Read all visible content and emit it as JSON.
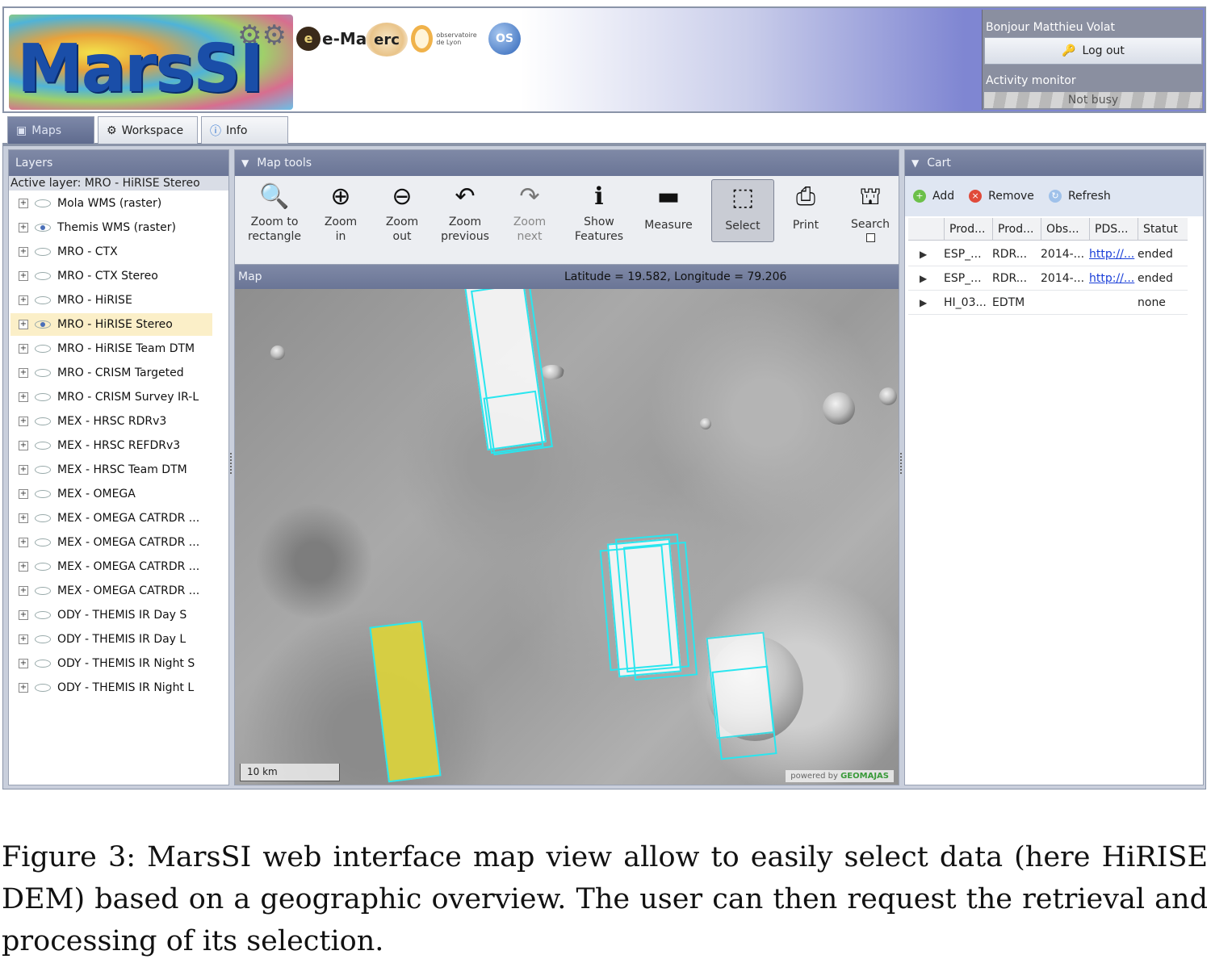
{
  "header": {
    "logo_text": "MarsSI",
    "partners": [
      "e-Mars",
      "erc",
      "observatoire de Lyon",
      "OS"
    ],
    "greeting": "Bonjour Matthieu Volat",
    "logout_label": "Log out",
    "activity_label": "Activity monitor",
    "activity_status": "Not busy"
  },
  "tabs": [
    {
      "label": "Maps",
      "active": true
    },
    {
      "label": "Workspace",
      "active": false
    },
    {
      "label": "Info",
      "active": false
    }
  ],
  "layers": {
    "title": "Layers",
    "active_layer": "Active layer: MRO - HiRISE Stereo",
    "items": [
      {
        "label": "Mola WMS (raster)",
        "visible": false
      },
      {
        "label": "Themis WMS (raster)",
        "visible": true
      },
      {
        "label": "MRO - CTX",
        "visible": false
      },
      {
        "label": "MRO - CTX Stereo",
        "visible": false
      },
      {
        "label": "MRO - HiRISE",
        "visible": false
      },
      {
        "label": "MRO - HiRISE Stereo",
        "visible": true,
        "selected": true
      },
      {
        "label": "MRO - HiRISE Team DTM",
        "visible": false
      },
      {
        "label": "MRO - CRISM Targeted",
        "visible": false
      },
      {
        "label": "MRO - CRISM Survey IR-L",
        "visible": false
      },
      {
        "label": "MEX - HRSC RDRv3",
        "visible": false
      },
      {
        "label": "MEX - HRSC REFDRv3",
        "visible": false
      },
      {
        "label": "MEX - HRSC Team DTM",
        "visible": false
      },
      {
        "label": "MEX - OMEGA",
        "visible": false
      },
      {
        "label": "MEX - OMEGA CATRDR ...",
        "visible": false
      },
      {
        "label": "MEX - OMEGA CATRDR ...",
        "visible": false
      },
      {
        "label": "MEX - OMEGA CATRDR ...",
        "visible": false
      },
      {
        "label": "MEX - OMEGA CATRDR ...",
        "visible": false
      },
      {
        "label": "ODY - THEMIS IR Day S",
        "visible": false
      },
      {
        "label": "ODY - THEMIS IR Day L",
        "visible": false
      },
      {
        "label": "ODY - THEMIS IR Night S",
        "visible": false
      },
      {
        "label": "ODY - THEMIS IR Night L",
        "visible": false
      }
    ]
  },
  "map_tools": {
    "title": "Map tools",
    "tools": [
      {
        "label1": "Zoom to",
        "label2": "rectangle",
        "icon": "zoom-rectangle-icon",
        "glyph": "🔍"
      },
      {
        "label1": "Zoom",
        "label2": "in",
        "icon": "zoom-in-icon",
        "glyph": "⊕"
      },
      {
        "label1": "Zoom",
        "label2": "out",
        "icon": "zoom-out-icon",
        "glyph": "⊖"
      },
      {
        "label1": "Zoom",
        "label2": "previous",
        "icon": "arrow-left-icon",
        "glyph": "↶"
      },
      {
        "label1": "Zoom",
        "label2": "next",
        "icon": "arrow-right-icon",
        "glyph": "↷",
        "disabled": true
      },
      {
        "label1": "Show",
        "label2": "Features",
        "icon": "info-icon",
        "glyph": "ℹ"
      },
      {
        "label1": "Measure",
        "label2": "",
        "icon": "ruler-icon",
        "glyph": "▬"
      },
      {
        "label1": "Select",
        "label2": "",
        "icon": "select-rectangle-icon",
        "glyph": "⬚",
        "pressed": true
      },
      {
        "label1": "Print",
        "label2": "",
        "icon": "printer-icon",
        "glyph": "⎙"
      },
      {
        "label1": "Search",
        "label2": "",
        "icon": "binoculars-icon",
        "glyph": "⛫",
        "checkbox": true
      }
    ]
  },
  "map": {
    "title": "Map",
    "coordinates": "Latitude = 19.582, Longitude = 79.206",
    "scale": "10 km",
    "powered_by": "powered by",
    "powered_brand": "GEOMAJAS"
  },
  "cart": {
    "title": "Cart",
    "actions": [
      "Add",
      "Remove",
      "Refresh"
    ],
    "columns": [
      "Prod...",
      "Prod...",
      "Obs...",
      "PDS...",
      "Statut"
    ],
    "rows": [
      {
        "c1": "ESP_...",
        "c2": "RDR...",
        "c3": "2014-...",
        "c4": "http://...",
        "c5": "ended"
      },
      {
        "c1": "ESP_...",
        "c2": "RDR...",
        "c3": "2014-...",
        "c4": "http://...",
        "c5": "ended"
      },
      {
        "c1": "HI_03...",
        "c2": "EDTM",
        "c3": "",
        "c4": "",
        "c5": "none"
      }
    ]
  },
  "caption": "Figure 3:  MarsSI web interface map view allow to easily select data (here HiRISE DEM) based on a geographic overview.  The user can then request the retrieval and processing of its selection."
}
